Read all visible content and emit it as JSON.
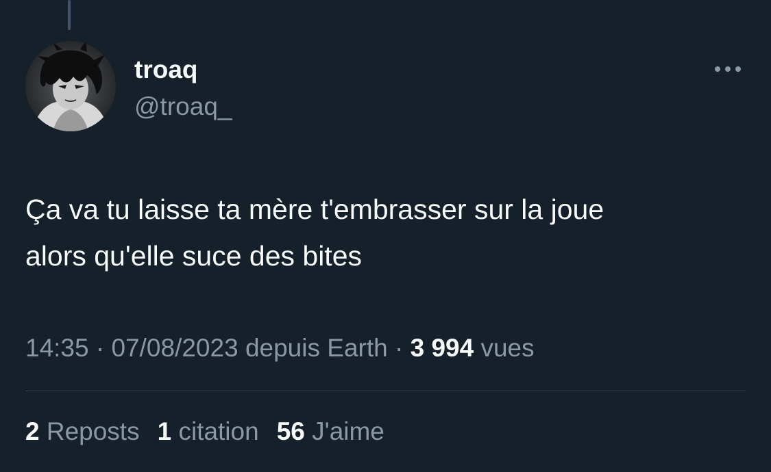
{
  "colors": {
    "background": "#15202b",
    "primary_text": "#f7f9f9",
    "secondary_text": "#8b98a5",
    "divider": "#38444d",
    "thread_line": "#42536a"
  },
  "author": {
    "display_name": "troaq",
    "handle": "@troaq_",
    "avatar_icon": "avatar-image"
  },
  "more_icon": "more-horizontal-icon",
  "tweet": {
    "lines": [
      "Ça va tu laisse ta mère t'embrasser sur la joue",
      "alors qu'elle suce des bites"
    ]
  },
  "meta": {
    "time": "14:35",
    "sep1": " · ",
    "date": "07/08/2023",
    "source": " depuis Earth",
    "sep2": " · ",
    "views_count": "3 994",
    "views_label": " vues"
  },
  "stats": {
    "reposts_count": "2",
    "reposts_label": " Reposts",
    "quotes_count": "1",
    "quotes_label": " citation",
    "likes_count": "56",
    "likes_label": " J'aime"
  }
}
